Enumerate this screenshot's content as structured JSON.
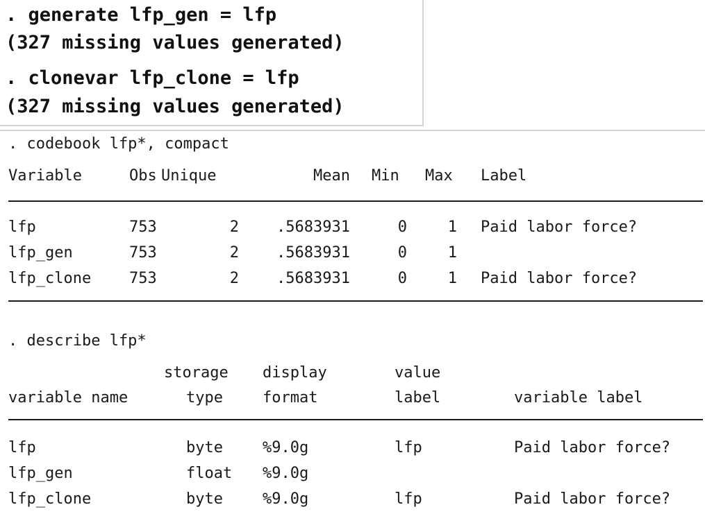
{
  "top": {
    "lines": [
      ". generate lfp_gen = lfp",
      "(327 missing values generated)",
      ". clonevar lfp_clone = lfp",
      "(327 missing values generated)"
    ]
  },
  "codebook": {
    "command": ". codebook lfp*, compact",
    "headers": {
      "variable": "Variable",
      "obs": "Obs",
      "unique": "Unique",
      "mean": "Mean",
      "min": "Min",
      "max": "Max",
      "label": "Label"
    },
    "rows": [
      {
        "variable": "lfp",
        "obs": "753",
        "unique": "2",
        "mean": ".5683931",
        "min": "0",
        "max": "1",
        "label": "Paid labor force?"
      },
      {
        "variable": "lfp_gen",
        "obs": "753",
        "unique": "2",
        "mean": ".5683931",
        "min": "0",
        "max": "1",
        "label": ""
      },
      {
        "variable": "lfp_clone",
        "obs": "753",
        "unique": "2",
        "mean": ".5683931",
        "min": "0",
        "max": "1",
        "label": "Paid labor force?"
      }
    ]
  },
  "describe": {
    "command": ". describe lfp*",
    "headers": {
      "storage": "storage",
      "type": "type",
      "display": "display",
      "format": "format",
      "value": "value",
      "value_label": "label",
      "variable_name": "variable name",
      "variable_label": "variable label"
    },
    "rows": [
      {
        "name": "lfp",
        "type": "byte",
        "format": "%9.0g",
        "value_label": "lfp",
        "label": "Paid labor force?"
      },
      {
        "name": "lfp_gen",
        "type": "float",
        "format": "%9.0g",
        "value_label": "",
        "label": ""
      },
      {
        "name": "lfp_clone",
        "type": "byte",
        "format": "%9.0g",
        "value_label": "lfp",
        "label": "Paid labor force?"
      }
    ]
  }
}
